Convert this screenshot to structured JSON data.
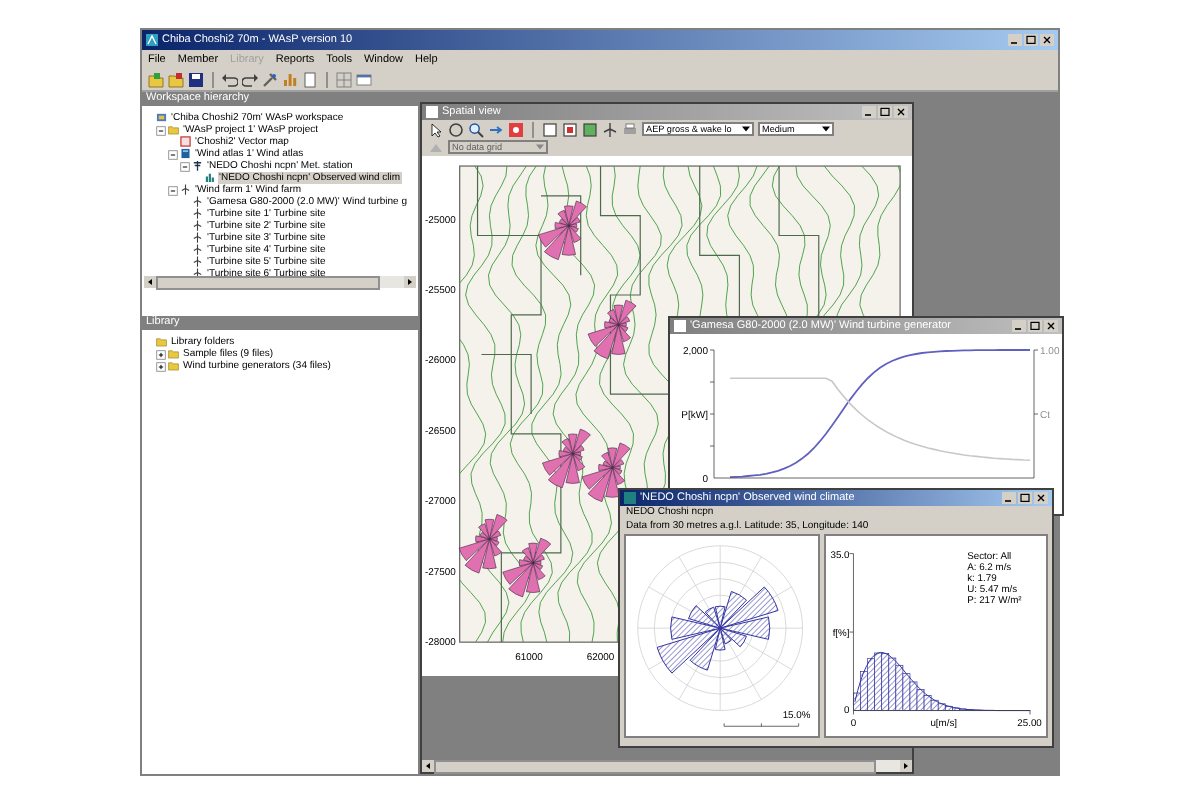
{
  "window": {
    "title": "Chiba Choshi2 70m - WAsP version 10"
  },
  "menu": [
    {
      "label": "File",
      "disabled": false
    },
    {
      "label": "Member",
      "disabled": false
    },
    {
      "label": "Library",
      "disabled": true
    },
    {
      "label": "Reports",
      "disabled": false
    },
    {
      "label": "Tools",
      "disabled": false
    },
    {
      "label": "Window",
      "disabled": false
    },
    {
      "label": "Help",
      "disabled": false
    }
  ],
  "workspace": {
    "title": "Workspace hierarchy",
    "tree": [
      {
        "label": "'Chiba Choshi2 70m' WAsP workspace",
        "kind": "workspace",
        "selected": false,
        "children": [
          {
            "label": "'WAsP project 1' WAsP project",
            "kind": "project",
            "selected": false,
            "expanded": true,
            "children": [
              {
                "label": "'Choshi2' Vector map",
                "kind": "map",
                "selected": false
              },
              {
                "label": "'Wind atlas 1' Wind atlas",
                "kind": "atlas",
                "selected": false,
                "expanded": true,
                "children": [
                  {
                    "label": "'NEDO Choshi ncpn' Met. station",
                    "kind": "station",
                    "selected": false,
                    "expanded": true,
                    "children": [
                      {
                        "label": "'NEDO Choshi ncpn' Observed wind clim",
                        "kind": "climate",
                        "selected": true
                      }
                    ]
                  }
                ]
              },
              {
                "label": "'Wind farm 1' Wind farm",
                "kind": "farm",
                "selected": false,
                "expanded": true,
                "children": [
                  {
                    "label": "'Gamesa G80-2000 (2.0 MW)' Wind turbine g",
                    "kind": "generator",
                    "selected": false
                  },
                  {
                    "label": "'Turbine site 1' Turbine site",
                    "kind": "site",
                    "selected": false
                  },
                  {
                    "label": "'Turbine site 2' Turbine site",
                    "kind": "site",
                    "selected": false
                  },
                  {
                    "label": "'Turbine site 3' Turbine site",
                    "kind": "site",
                    "selected": false
                  },
                  {
                    "label": "'Turbine site 4' Turbine site",
                    "kind": "site",
                    "selected": false
                  },
                  {
                    "label": "'Turbine site 5' Turbine site",
                    "kind": "site",
                    "selected": false
                  },
                  {
                    "label": "'Turbine site 6' Turbine site",
                    "kind": "site",
                    "selected": false
                  }
                ]
              }
            ]
          }
        ]
      }
    ]
  },
  "library": {
    "title": "Library",
    "tree": [
      {
        "label": "Library folders",
        "kind": "library",
        "selected": false,
        "children": [
          {
            "label": "Sample files (9 files)",
            "kind": "folder",
            "selected": false,
            "expanded": false
          },
          {
            "label": "Wind turbine generators (34 files)",
            "kind": "folder",
            "selected": false,
            "expanded": false
          }
        ]
      }
    ]
  },
  "spatial_view": {
    "title": "Spatial view",
    "active": false,
    "toolbar_dropdowns": [
      {
        "value": "AEP gross & wake lo",
        "disabled": false
      },
      {
        "value": "Medium",
        "disabled": false
      }
    ],
    "grid_dropdown": {
      "value": "No data grid",
      "disabled": true
    },
    "y_labels": [
      "-25000",
      "-25500",
      "-26000",
      "-26500",
      "-27000",
      "-27500",
      "-28000"
    ],
    "x_labels": [
      "61000",
      "62000"
    ]
  },
  "power_curve": {
    "title": "'Gamesa G80-2000 (2.0 MW)' Wind turbine generator",
    "active": false,
    "y_max": "2,000",
    "y_min": "0",
    "y_label": "P[kW]",
    "right_max": "1.00",
    "right_label": "Ct"
  },
  "wind_climate": {
    "title": "'NEDO Choshi ncpn' Observed wind climate",
    "active": true,
    "station": "NEDO Choshi ncpn",
    "description": "Data from 30 metres a.g.l. Latitude: 35, Longitude: 140",
    "rose_scale": "15.0%",
    "histogram": {
      "y_max": "35.0",
      "y_min": "0",
      "y_label": "f[%]",
      "x_min": "0",
      "x_label": "u[m/s]",
      "x_max": "25.00",
      "stats": [
        "Sector: All",
        "A: 6.2 m/s",
        "k: 1.79",
        "U: 5.47 m/s",
        "P: 217 W/m²"
      ]
    }
  }
}
